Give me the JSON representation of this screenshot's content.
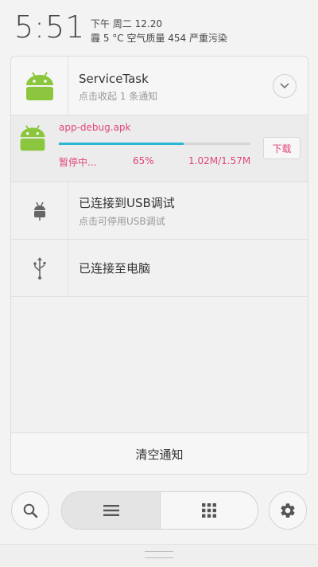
{
  "status_bar": {
    "time": "5:51",
    "line1": "下午 周二   12.20",
    "line2": "霾  5 °C  空气质量 454  严重污染"
  },
  "notifications": {
    "app_group": {
      "title": "ServiceTask",
      "subtitle": "点击收起 1 条通知",
      "icon": "android-icon"
    },
    "download": {
      "filename": "app-debug.apk",
      "status": "暂停中...",
      "percent_text": "65%",
      "progress": 0.65,
      "size": "1.02M/1.57M",
      "button": "下载",
      "icon": "android-icon"
    },
    "usb_debug": {
      "title": "已连接到USB调试",
      "subtitle": "点击可停用USB调试",
      "icon": "android-debug-icon"
    },
    "usb_pc": {
      "title": "已连接至电脑",
      "icon": "usb-icon"
    },
    "clear_all": "清空通知"
  },
  "bottom_bar": {
    "search_icon": "search-icon",
    "list_icon": "list-icon",
    "grid_icon": "grid-icon",
    "settings_icon": "gear-icon"
  },
  "colors": {
    "accent_pink": "#e0457b",
    "progress_blue": "#2bb6d4",
    "android_green": "#8cc63e"
  }
}
